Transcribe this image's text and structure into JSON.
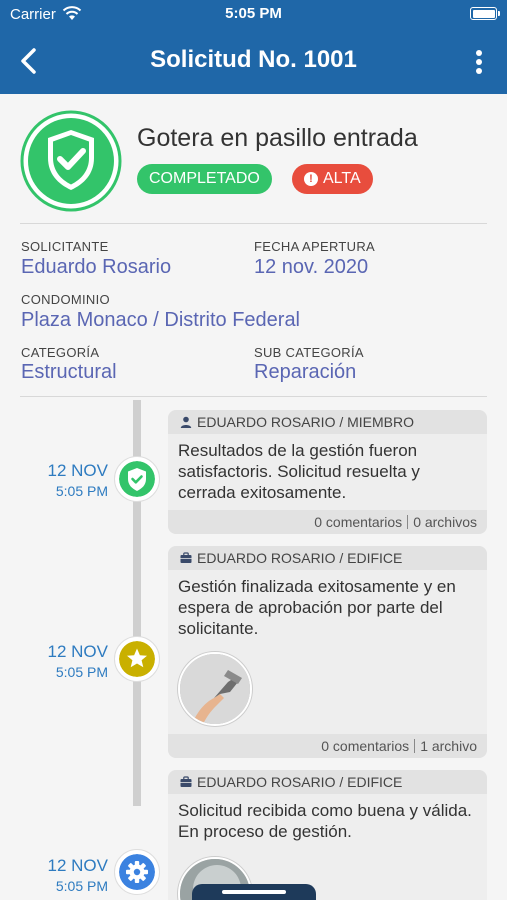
{
  "status_bar": {
    "carrier": "Carrier",
    "time": "5:05 PM"
  },
  "nav": {
    "title": "Solicitud No. 1001"
  },
  "request": {
    "title": "Gotera en pasillo entrada",
    "status_badge": "COMPLETADO",
    "priority_badge": "ALTA",
    "fields": {
      "solicitante_label": "SOLICITANTE",
      "solicitante_value": "Eduardo Rosario",
      "fecha_label": "FECHA APERTURA",
      "fecha_value": "12 nov. 2020",
      "condominio_label": "CONDOMINIO",
      "condominio_value": "Plaza Monaco / Distrito Federal",
      "categoria_label": "CATEGORÍA",
      "categoria_value": "Estructural",
      "subcategoria_label": "SUB CATEGORÍA",
      "subcategoria_value": "Reparación"
    }
  },
  "timeline": [
    {
      "date": "12 NOV",
      "time": "5:05 PM",
      "author": "EDUARDO ROSARIO / MIEMBRO",
      "author_icon": "person-icon",
      "message": "Resultados de la gestión fueron satisfactoris. Solicitud resuelta y cerrada exitosamente.",
      "comments": "0 comentarios",
      "files": "0 archivos",
      "node_icon": "shield-check-icon",
      "node_color": "#33c46a"
    },
    {
      "date": "12 NOV",
      "time": "5:05 PM",
      "author": "EDUARDO ROSARIO / EDIFICE",
      "author_icon": "briefcase-icon",
      "message": "Gestión finalizada exitosamente y en espera de aprobación por parte del solicitante.",
      "comments": "0 comentarios",
      "files": "1 archivo",
      "node_icon": "star-icon",
      "node_color": "#c9b000"
    },
    {
      "date": "12 NOV",
      "time": "5:05 PM",
      "author": "EDUARDO ROSARIO / EDIFICE",
      "author_icon": "briefcase-icon",
      "message": "Solicitud recibida como buena y válida. En proceso de gestión.",
      "node_icon": "gear-icon",
      "node_color": "#3b82e0"
    }
  ],
  "colors": {
    "primary": "#1f67a8",
    "link": "#5a66b3",
    "completed": "#33c46a",
    "priority": "#e84d3d"
  }
}
